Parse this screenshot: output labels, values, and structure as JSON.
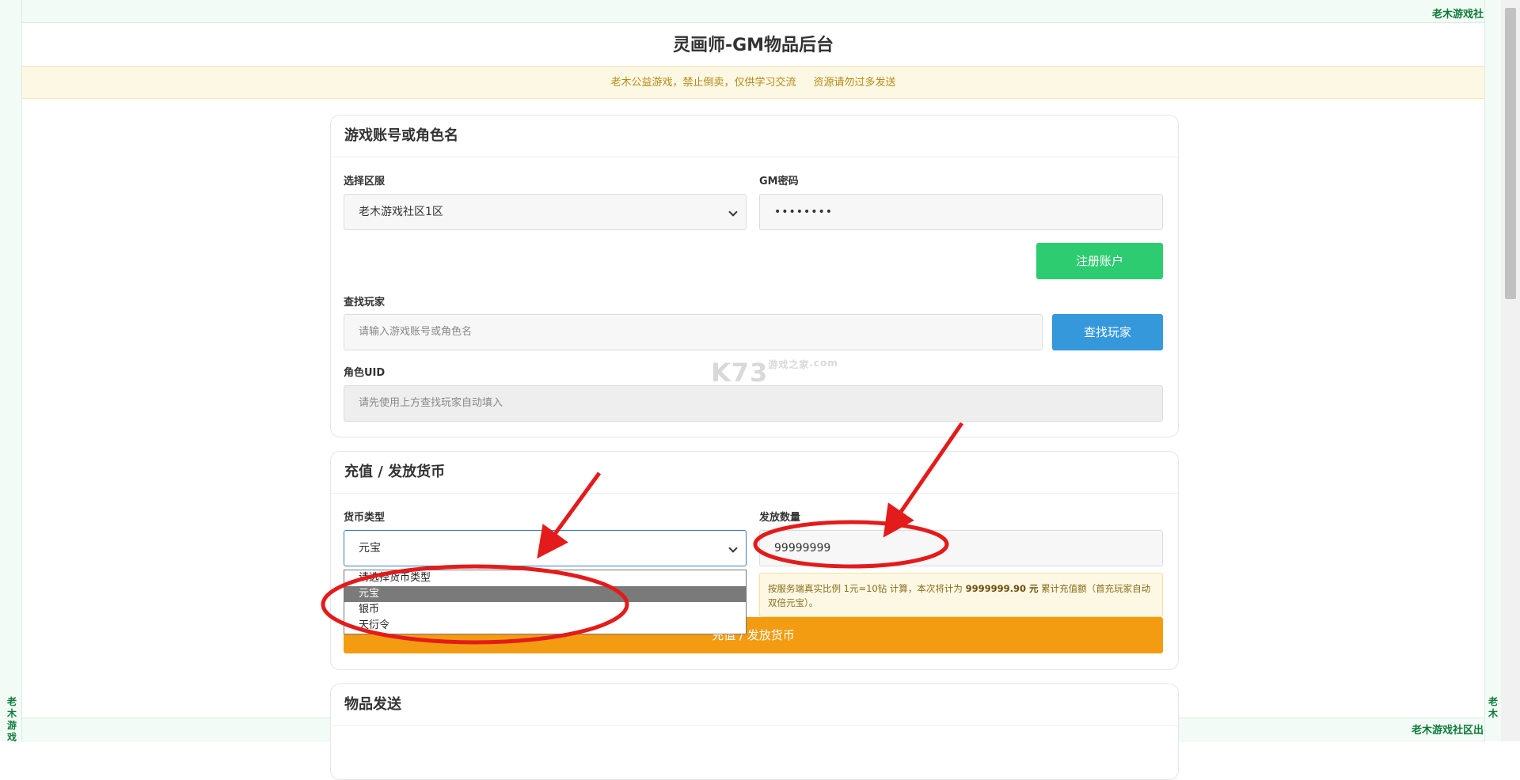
{
  "brand": {
    "corner_text": "老木游戏社",
    "bottom_text": "老木游戏社区出",
    "vertical_left": "老木游戏",
    "vertical_right": "老木"
  },
  "header": {
    "title": "灵画师-GM物品后台"
  },
  "notice": {
    "text_1": "老木公益游戏，禁止倒卖，仅供学习交流",
    "text_2": "资源请勿过多发送"
  },
  "account_card": {
    "title": "游戏账号或角色名",
    "server_label": "选择区服",
    "server_value": "老木游戏社区1区",
    "gm_password_label": "GM密码",
    "gm_password_value": "••••••••",
    "register_button": "注册账户",
    "search_label": "查找玩家",
    "search_placeholder": "请输入游戏账号或角色名",
    "search_button": "查找玩家",
    "uid_label": "角色UID",
    "uid_placeholder": "请先使用上方查找玩家自动填入"
  },
  "currency_card": {
    "title": "充值 / 发放货币",
    "type_label": "货币类型",
    "type_value": "元宝",
    "type_options": [
      "请选择货币类型",
      "元宝",
      "银币",
      "天衍令"
    ],
    "amount_label": "发放数量",
    "amount_value": "99999999",
    "hint_prefix": "按服务端真实比例 1元=10钻 计算，本次将计为",
    "hint_amount": "9999999.90 元",
    "hint_suffix": "累计充值额（首充玩家自动双倍元宝）。",
    "submit_button": "充值 / 发放货币"
  },
  "items_card": {
    "title": "物品发送"
  },
  "watermark": {
    "main": "K73",
    "sub": "游戏之家",
    "domain": ".com"
  },
  "colors": {
    "green": "#2ecc71",
    "blue": "#3498db",
    "orange": "#f39c12",
    "annotation_red": "#e31b1b"
  }
}
